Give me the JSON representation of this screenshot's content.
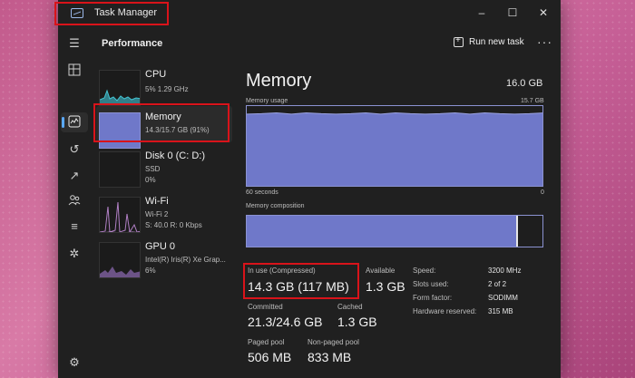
{
  "window": {
    "title": "Task Manager"
  },
  "header": {
    "title": "Performance",
    "run_new_task": "Run new task"
  },
  "list": {
    "items": [
      {
        "name": "CPU",
        "sub": [
          "5%  1.29 GHz"
        ]
      },
      {
        "name": "Memory",
        "sub": [
          "14.3/15.7 GB (91%)"
        ]
      },
      {
        "name": "Disk 0 (C: D:)",
        "sub": [
          "SSD",
          "0%"
        ]
      },
      {
        "name": "Wi-Fi",
        "sub": [
          "Wi-Fi 2",
          "S: 40.0  R: 0 Kbps"
        ]
      },
      {
        "name": "GPU 0",
        "sub": [
          "Intel(R) Iris(R) Xe Grap...",
          "6%"
        ]
      }
    ]
  },
  "memory": {
    "title": "Memory",
    "total": "16.0 GB",
    "usage_label": "Memory usage",
    "usage_max": "15.7 GB",
    "usage_percent": 91,
    "x_left": "60 seconds",
    "x_right": "0",
    "composition_label": "Memory composition",
    "composition_used_fraction": 0.91
  },
  "stats": {
    "in_use_label": "In use (Compressed)",
    "in_use_value": "14.3 GB (117 MB)",
    "available_label": "Available",
    "available_value": "1.3 GB",
    "committed_label": "Committed",
    "committed_value": "21.3/24.6 GB",
    "cached_label": "Cached",
    "cached_value": "1.3 GB",
    "paged_label": "Paged pool",
    "paged_value": "506 MB",
    "nonpaged_label": "Non-paged pool",
    "nonpaged_value": "833 MB"
  },
  "specs": [
    {
      "label": "Speed:",
      "value": "3200 MHz"
    },
    {
      "label": "Slots used:",
      "value": "2 of 2"
    },
    {
      "label": "Form factor:",
      "value": "SODIMM"
    },
    {
      "label": "Hardware reserved:",
      "value": "315 MB"
    }
  ],
  "colors": {
    "accent": "#8b92d1",
    "fill": "#6f78c9",
    "highlight": "#d9131a"
  },
  "icons": {
    "window": [
      "minimize-icon",
      "maximize-icon",
      "close-icon"
    ],
    "sidebar": [
      "hamburger-icon",
      "processes-icon",
      "performance-icon",
      "app-history-icon",
      "startup-apps-icon",
      "users-icon",
      "details-icon",
      "services-icon",
      "settings-icon"
    ]
  }
}
